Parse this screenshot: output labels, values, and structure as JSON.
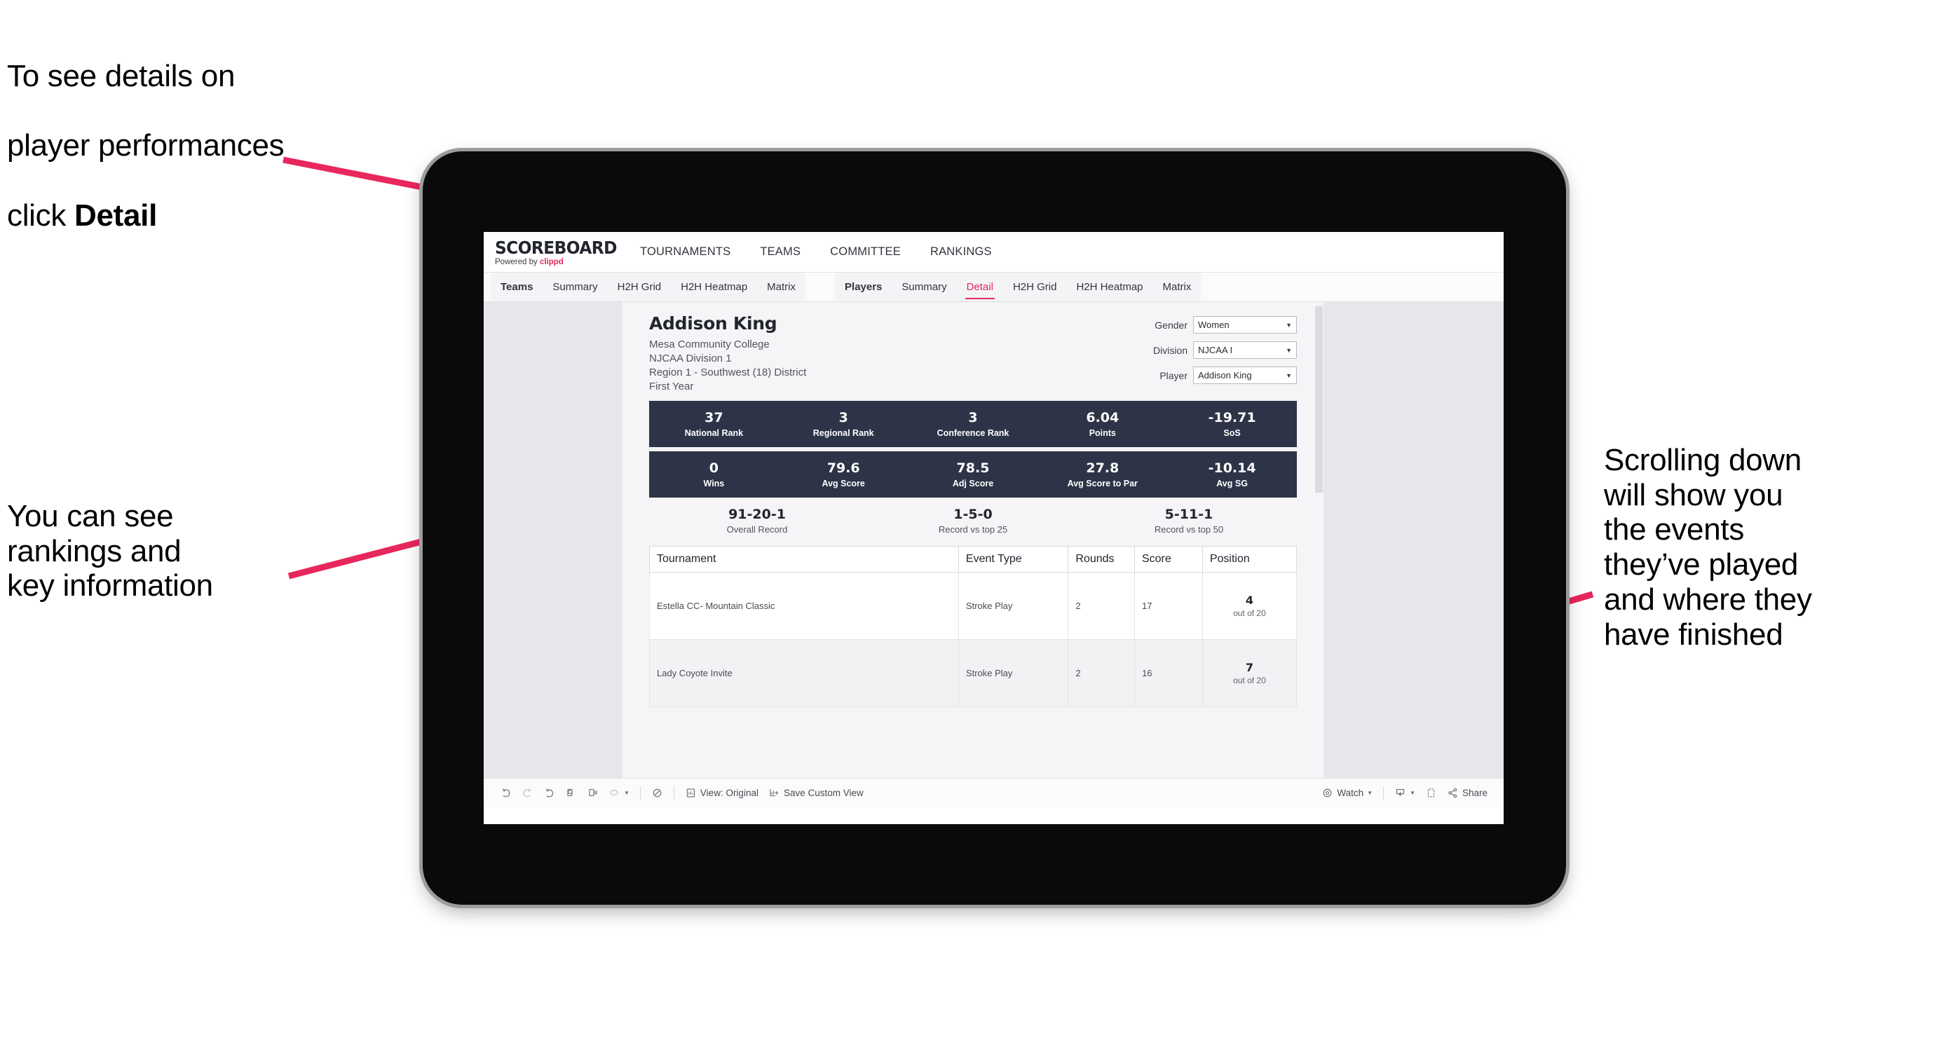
{
  "annotations": {
    "top_left": {
      "line1": "To see details on",
      "line2": "player performances",
      "line3_prefix": "click ",
      "line3_bold": "Detail"
    },
    "left": {
      "text": "You can see\nrankings and\nkey information"
    },
    "right": {
      "text": "Scrolling down\nwill show you\nthe events\nthey’ve played\nand where they\nhave finished"
    }
  },
  "accent_color": "#e8275c",
  "band_color": "#2d3447",
  "app": {
    "logo": {
      "main": "SCOREBOARD",
      "powered_prefix": "Powered by ",
      "brand": "clippd"
    },
    "nav": [
      {
        "label": "TOURNAMENTS"
      },
      {
        "label": "TEAMS"
      },
      {
        "label": "COMMITTEE"
      },
      {
        "label": "RANKINGS"
      }
    ],
    "tab_groups": [
      {
        "tabs": [
          {
            "label": "Teams",
            "lead": true,
            "active": false
          },
          {
            "label": "Summary",
            "lead": false,
            "active": false
          },
          {
            "label": "H2H Grid",
            "lead": false,
            "active": false
          },
          {
            "label": "H2H Heatmap",
            "lead": false,
            "active": false
          },
          {
            "label": "Matrix",
            "lead": false,
            "active": false
          }
        ]
      },
      {
        "tabs": [
          {
            "label": "Players",
            "lead": true,
            "active": false
          },
          {
            "label": "Summary",
            "lead": false,
            "active": false
          },
          {
            "label": "Detail",
            "lead": false,
            "active": true
          },
          {
            "label": "H2H Grid",
            "lead": false,
            "active": false
          },
          {
            "label": "H2H Heatmap",
            "lead": false,
            "active": false
          },
          {
            "label": "Matrix",
            "lead": false,
            "active": false
          }
        ]
      }
    ]
  },
  "player": {
    "name": "Addison King",
    "school": "Mesa Community College",
    "division": "NJCAA Division 1",
    "region": "Region 1 - Southwest (18) District",
    "year": "First Year"
  },
  "filters": [
    {
      "label": "Gender",
      "value": "Women"
    },
    {
      "label": "Division",
      "value": "NJCAA I"
    },
    {
      "label": "Player",
      "value": "Addison King"
    }
  ],
  "stat_bands": [
    {
      "cells": [
        {
          "value": "37",
          "label": "National Rank"
        },
        {
          "value": "3",
          "label": "Regional Rank"
        },
        {
          "value": "3",
          "label": "Conference Rank"
        },
        {
          "value": "6.04",
          "label": "Points"
        },
        {
          "value": "-19.71",
          "label": "SoS"
        }
      ]
    },
    {
      "cells": [
        {
          "value": "0",
          "label": "Wins"
        },
        {
          "value": "79.6",
          "label": "Avg Score"
        },
        {
          "value": "78.5",
          "label": "Adj Score"
        },
        {
          "value": "27.8",
          "label": "Avg Score to Par"
        },
        {
          "value": "-10.14",
          "label": "Avg SG"
        }
      ]
    }
  ],
  "records": [
    {
      "value": "91-20-1",
      "label": "Overall Record"
    },
    {
      "value": "1-5-0",
      "label": "Record vs top 25"
    },
    {
      "value": "5-11-1",
      "label": "Record vs top 50"
    }
  ],
  "table": {
    "headers": [
      "Tournament",
      "Event Type",
      "Rounds",
      "Score",
      "Position"
    ],
    "rows": [
      {
        "tournament": "Estella CC- Mountain Classic",
        "event_type": "Stroke Play",
        "rounds": "2",
        "score": "17",
        "position_num": "4",
        "position_of": "out of 20"
      },
      {
        "tournament": "Lady Coyote Invite",
        "event_type": "Stroke Play",
        "rounds": "2",
        "score": "16",
        "position_num": "7",
        "position_of": "out of 20"
      }
    ]
  },
  "toolbar": {
    "view_label": "View: Original",
    "save_label": "Save Custom View",
    "watch_label": "Watch",
    "share_label": "Share"
  }
}
